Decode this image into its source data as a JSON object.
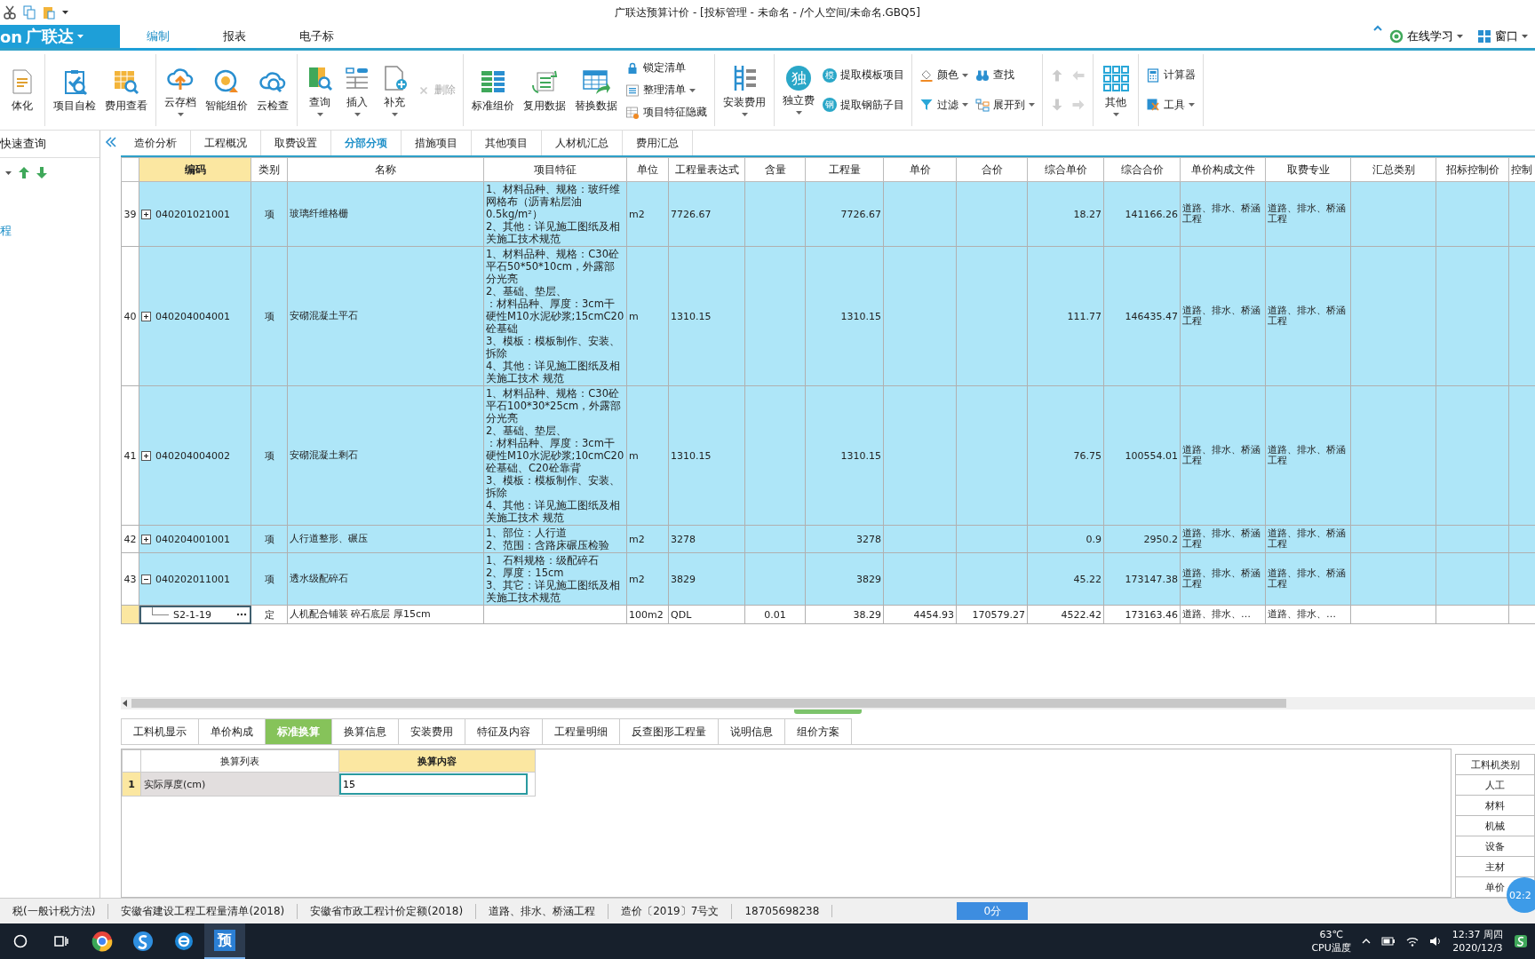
{
  "window": {
    "title": "广联达预算计价 - [投标管理 - 未命名 - /个人空间/未命名.GBQ5]"
  },
  "logo": {
    "fragment": "on",
    "brand": "广联达"
  },
  "menu_tabs": [
    {
      "label": "编制",
      "selected": true
    },
    {
      "label": "报表",
      "selected": false
    },
    {
      "label": "电子标",
      "selected": false
    }
  ],
  "help_menu": [
    {
      "label": "在线学习"
    },
    {
      "label": "窗口"
    }
  ],
  "ribbon": [
    {
      "columns": [
        [
          {
            "kind": "large",
            "label": "体化",
            "dropdown": false,
            "disabled": false
          }
        ]
      ]
    },
    {
      "columns": [
        [
          {
            "kind": "large",
            "label": "项目自检",
            "dropdown": false,
            "disabled": false
          }
        ],
        [
          {
            "kind": "large",
            "label": "费用查看",
            "dropdown": false,
            "disabled": false
          }
        ]
      ]
    },
    {
      "columns": [
        [
          {
            "kind": "large",
            "label": "云存档",
            "dropdown": true,
            "disabled": false
          }
        ],
        [
          {
            "kind": "large",
            "label": "智能组价",
            "dropdown": false,
            "disabled": false
          }
        ],
        [
          {
            "kind": "large",
            "label": "云检查",
            "dropdown": false,
            "disabled": false
          }
        ]
      ]
    },
    {
      "columns": [
        [
          {
            "kind": "large",
            "label": "查询",
            "dropdown": true,
            "disabled": false
          }
        ],
        [
          {
            "kind": "large",
            "label": "插入",
            "dropdown": true,
            "disabled": false
          }
        ],
        [
          {
            "kind": "large",
            "label": "补充",
            "dropdown": true,
            "disabled": false
          }
        ],
        [
          {
            "kind": "small",
            "label": "删除",
            "dropdown": false,
            "disabled": true
          }
        ]
      ]
    },
    {
      "columns": [
        [
          {
            "kind": "large",
            "label": "标准组价",
            "dropdown": false,
            "disabled": false
          }
        ],
        [
          {
            "kind": "large",
            "label": "复用数据",
            "dropdown": false,
            "disabled": false
          }
        ],
        [
          {
            "kind": "large",
            "label": "替换数据",
            "dropdown": false,
            "disabled": false
          }
        ],
        [
          {
            "kind": "small",
            "label": "锁定清单",
            "dropdown": false,
            "disabled": false
          },
          {
            "kind": "small",
            "label": "整理清单",
            "dropdown": true,
            "disabled": false
          },
          {
            "kind": "small",
            "label": "项目特征隐藏",
            "dropdown": false,
            "disabled": false
          }
        ]
      ]
    },
    {
      "columns": [
        [
          {
            "kind": "large",
            "label": "安装费用",
            "dropdown": true,
            "disabled": false
          }
        ]
      ]
    },
    {
      "columns": [
        [
          {
            "kind": "large",
            "label": "独立费",
            "icon_text": "独",
            "dropdown": true,
            "disabled": false
          }
        ],
        [
          {
            "kind": "small",
            "label": "提取模板项目",
            "icon_text": "模",
            "dropdown": false,
            "disabled": false
          },
          {
            "kind": "small",
            "label": "提取钢筋子目",
            "icon_text": "钢",
            "dropdown": false,
            "disabled": false
          }
        ]
      ]
    },
    {
      "columns": [
        [
          {
            "kind": "small",
            "label": "颜色",
            "dropdown": true,
            "disabled": false
          },
          {
            "kind": "small",
            "label": "过滤",
            "dropdown": true,
            "disabled": false
          }
        ],
        [
          {
            "kind": "small",
            "label": "查找",
            "dropdown": false,
            "disabled": false
          },
          {
            "kind": "small",
            "label": "展开到",
            "dropdown": true,
            "disabled": false
          }
        ]
      ]
    },
    {
      "columns": [
        [
          {
            "kind": "icon",
            "dropdown": false,
            "disabled": true
          },
          {
            "kind": "icon",
            "dropdown": false,
            "disabled": true
          }
        ],
        [
          {
            "kind": "icon",
            "dropdown": false,
            "disabled": true
          },
          {
            "kind": "icon",
            "dropdown": false,
            "disabled": true
          }
        ]
      ]
    },
    {
      "columns": [
        [
          {
            "kind": "large",
            "label": "其他",
            "dropdown": true,
            "disabled": false
          }
        ]
      ]
    },
    {
      "columns": [
        [
          {
            "kind": "small",
            "label": "计算器",
            "dropdown": false,
            "disabled": false
          },
          {
            "kind": "small",
            "label": "工具",
            "dropdown": true,
            "disabled": false
          }
        ]
      ]
    }
  ],
  "left_panel": {
    "title": "快速查询",
    "fragments": [
      "程"
    ]
  },
  "tabs": [
    {
      "label": "造价分析",
      "selected": false
    },
    {
      "label": "工程概况",
      "selected": false
    },
    {
      "label": "取费设置",
      "selected": false
    },
    {
      "label": "分部分项",
      "selected": true
    },
    {
      "label": "措施项目",
      "selected": false
    },
    {
      "label": "其他项目",
      "selected": false
    },
    {
      "label": "人材机汇总",
      "selected": false
    },
    {
      "label": "费用汇总",
      "selected": false
    }
  ],
  "grid": {
    "columns": [
      {
        "label": "编码",
        "selected": true
      },
      {
        "label": "类别",
        "selected": false
      },
      {
        "label": "名称",
        "selected": false
      },
      {
        "label": "项目特征",
        "selected": false
      },
      {
        "label": "单位",
        "selected": false
      },
      {
        "label": "工程量表达式",
        "selected": false
      },
      {
        "label": "含量",
        "selected": false
      },
      {
        "label": "工程量",
        "selected": false
      },
      {
        "label": "单价",
        "selected": false
      },
      {
        "label": "合价",
        "selected": false
      },
      {
        "label": "综合单价",
        "selected": false
      },
      {
        "label": "综合合价",
        "selected": false
      },
      {
        "label": "单价构成文件",
        "selected": false
      },
      {
        "label": "取费专业",
        "selected": false
      },
      {
        "label": "汇总类别",
        "selected": false
      },
      {
        "label": "招标控制价",
        "selected": false
      },
      {
        "label": "控制",
        "selected": false
      }
    ],
    "rows": [
      {
        "kind": "item",
        "number": "39",
        "expanded": false,
        "selected": false,
        "code": "040201021001",
        "type": "项",
        "name": "玻璃纤维格栅",
        "features": [
          "1、材料品种、规格：玻纤维网格布（沥青粘层油0.5kg/m²）",
          "2、其他：详见施工图纸及相关施工技术规范"
        ],
        "unit": "m2",
        "expression": "7726.67",
        "quantity": "7726.67",
        "combined_unit_price": "18.27",
        "combined_total": "141166.26",
        "price_file": "道路、排水、桥涵工程",
        "fee_specialty": "道路、排水、桥涵工程"
      },
      {
        "kind": "item",
        "number": "40",
        "expanded": false,
        "selected": false,
        "code": "040204004001",
        "type": "项",
        "name": "安砌混凝土平石",
        "features": [
          "1、材料品种、规格：C30砼平石50*50*10cm，外露部分光亮",
          "2、基础、垫层、",
          "：材料品种、厚度：3cm干硬性M10水泥砂浆;15cmC20砼基础",
          "3、模板：模板制作、安装、拆除",
          "4、其他：详见施工图纸及相关施工技术 规范"
        ],
        "unit": "m",
        "expression": "1310.15",
        "quantity": "1310.15",
        "combined_unit_price": "111.77",
        "combined_total": "146435.47",
        "price_file": "道路、排水、桥涵工程",
        "fee_specialty": "道路、排水、桥涵工程"
      },
      {
        "kind": "item",
        "number": "41",
        "expanded": false,
        "selected": false,
        "code": "040204004002",
        "type": "项",
        "name": "安砌混凝土剩石",
        "features": [
          "1、材料品种、规格：C30砼平石100*30*25cm，外露部分光亮",
          "2、基础、垫层、",
          "：材料品种、厚度：3cm干硬性M10水泥砂浆;10cmC20砼基础、C20砼靠背",
          "3、模板：模板制作、安装、拆除",
          "4、其他：详见施工图纸及相关施工技术 规范"
        ],
        "unit": "m",
        "expression": "1310.15",
        "quantity": "1310.15",
        "combined_unit_price": "76.75",
        "combined_total": "100554.01",
        "price_file": "道路、排水、桥涵工程",
        "fee_specialty": "道路、排水、桥涵工程"
      },
      {
        "kind": "item",
        "number": "42",
        "expanded": false,
        "selected": false,
        "code": "040204001001",
        "type": "项",
        "name": "人行道整形、碾压",
        "features": [
          "1、部位：人行道",
          "2、范围：含路床碾压检验"
        ],
        "unit": "m2",
        "expression": "3278",
        "quantity": "3278",
        "combined_unit_price": "0.9",
        "combined_total": "2950.2",
        "price_file": "道路、排水、桥涵工程",
        "fee_specialty": "道路、排水、桥涵工程"
      },
      {
        "kind": "item",
        "number": "43",
        "expanded": true,
        "selected": false,
        "code": "040202011001",
        "type": "项",
        "name": "透水级配碎石",
        "features": [
          "1、石料规格：级配碎石",
          "2、厚度：15cm",
          "3、其它：详见施工图纸及相关施工技术规范"
        ],
        "unit": "m2",
        "expression": "3829",
        "quantity": "3829",
        "combined_unit_price": "45.22",
        "combined_total": "173147.38",
        "price_file": "道路、排水、桥涵工程",
        "fee_specialty": "道路、排水、桥涵工程",
        "children": [
          {
            "kind": "quota",
            "selected": true,
            "code": "S2-1-19",
            "type": "定",
            "name": "人机配合铺装 碎石底层 厚15cm",
            "unit": "100m2",
            "expression": "QDL",
            "content": "0.01",
            "quantity": "38.29",
            "unit_price": "4454.93",
            "total_price": "170579.27",
            "combined_unit_price": "4522.42",
            "combined_total": "173163.46",
            "price_file": "道路、排水、…",
            "fee_specialty": "道路、排水、…"
          }
        ]
      }
    ]
  },
  "detail_tabs": [
    {
      "label": "工料机显示",
      "selected": false
    },
    {
      "label": "单价构成",
      "selected": false
    },
    {
      "label": "标准换算",
      "selected": true
    },
    {
      "label": "换算信息",
      "selected": false
    },
    {
      "label": "安装费用",
      "selected": false
    },
    {
      "label": "特征及内容",
      "selected": false
    },
    {
      "label": "工程量明细",
      "selected": false
    },
    {
      "label": "反查图形工程量",
      "selected": false
    },
    {
      "label": "说明信息",
      "selected": false
    },
    {
      "label": "组价方案",
      "selected": false
    }
  ],
  "conversion": {
    "columns": [
      {
        "label": "换算列表",
        "selected": false
      },
      {
        "label": "换算内容",
        "selected": true
      }
    ],
    "rows": [
      {
        "number": "1",
        "selected": true,
        "item": "实际厚度(cm)",
        "value": "15"
      }
    ]
  },
  "resource_types": {
    "header": "工料机类别",
    "rows": [
      "人工",
      "材料",
      "机械",
      "设备",
      "主材",
      "单价"
    ]
  },
  "timer": "02:2",
  "status_bar": {
    "items": [
      "税(一般计税方法)",
      "安徽省建设工程工程量清单(2018)",
      "安徽省市政工程计价定额(2018)",
      "道路、排水、桥涵工程",
      "造价〔2019〕7号文",
      "18705698238"
    ],
    "score": "0分"
  },
  "taskbar": {
    "apps": [
      {
        "selected": false
      },
      {
        "selected": false
      },
      {
        "selected": false
      },
      {
        "label": "预",
        "selected": true
      }
    ],
    "temperature": "63℃",
    "sensor": "CPU温度",
    "time": "12:37 周四",
    "date": "2020/12/3"
  }
}
